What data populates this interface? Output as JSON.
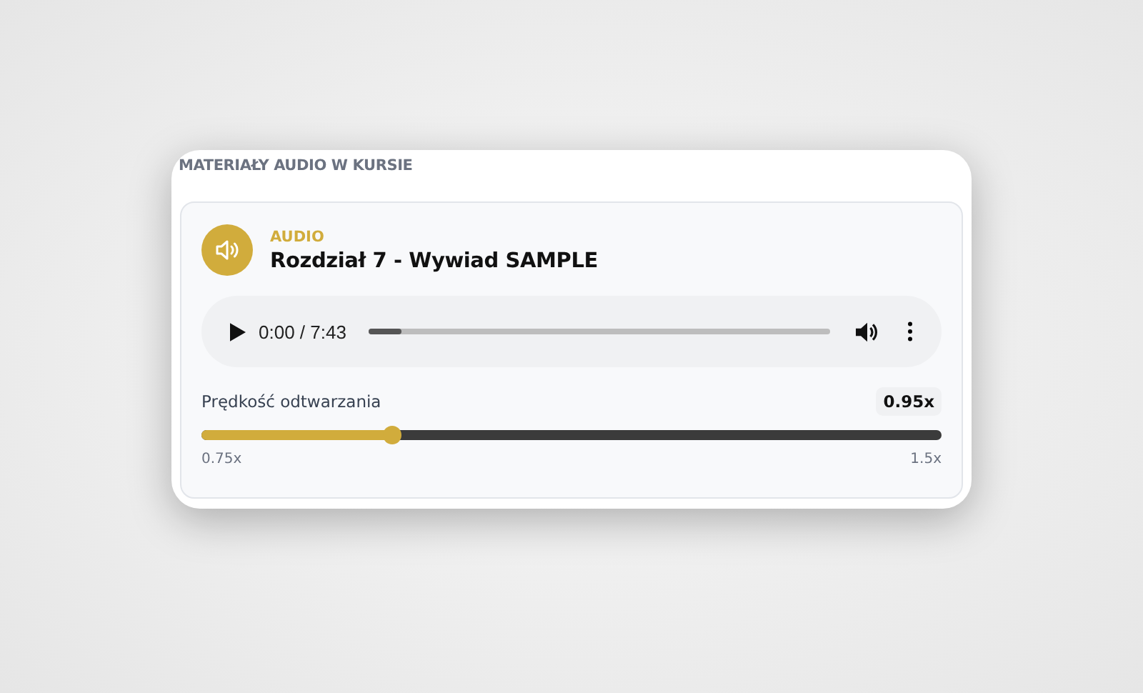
{
  "section_title": "MATERIAŁY AUDIO W KURSIE",
  "item": {
    "type_label": "AUDIO",
    "title": "Rozdział 7 - Wywiad SAMPLE"
  },
  "player": {
    "time": "0:00 / 7:43",
    "level": 0.07
  },
  "speed": {
    "label": "Prędkość odtwarzania",
    "value": "0.95x",
    "level": 0.257,
    "min_label": "0.75x",
    "max_label": "1.5x"
  }
}
